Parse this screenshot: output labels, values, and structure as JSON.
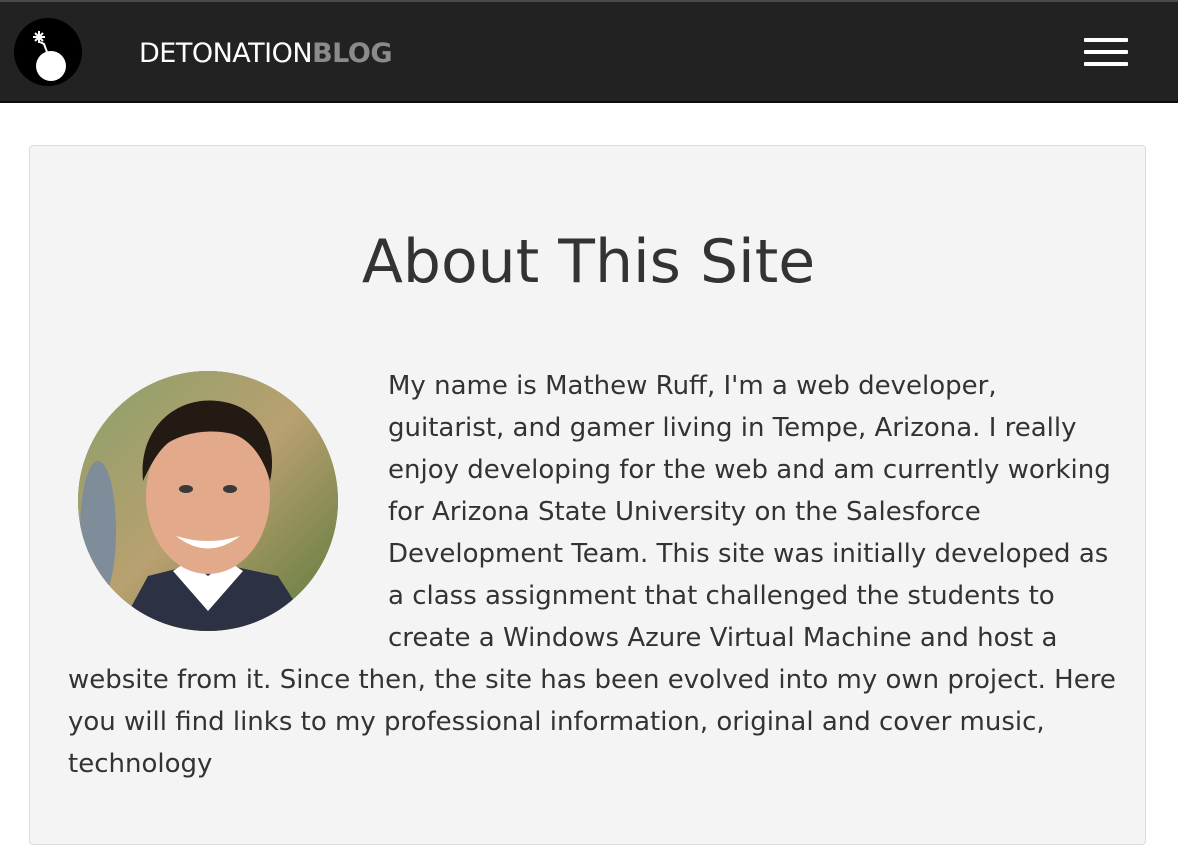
{
  "header": {
    "brand_primary": "DETONATION",
    "brand_secondary": "BLOG",
    "logo_icon": "bomb-icon",
    "menu_icon": "hamburger-menu-icon"
  },
  "about": {
    "title": "About This Site",
    "avatar_icon": "profile-photo",
    "paragraph": "My name is Mathew Ruff, I'm a web developer, guitarist, and gamer living in Tempe, Arizona. I really enjoy developing for the web and am currently working for Arizona State University on the Salesforce Development Team. This site was initially developed as a class assignment that challenged the students to create a Windows Azure Virtual Machine and host a website from it. Since then, the site has been evolved into my own project. Here you will find links to my professional information, original and cover music, technology"
  },
  "colors": {
    "navbar": "#222222",
    "brand_secondary": "#8b8b8b",
    "panel": "#f4f4f4",
    "text": "#333333"
  }
}
